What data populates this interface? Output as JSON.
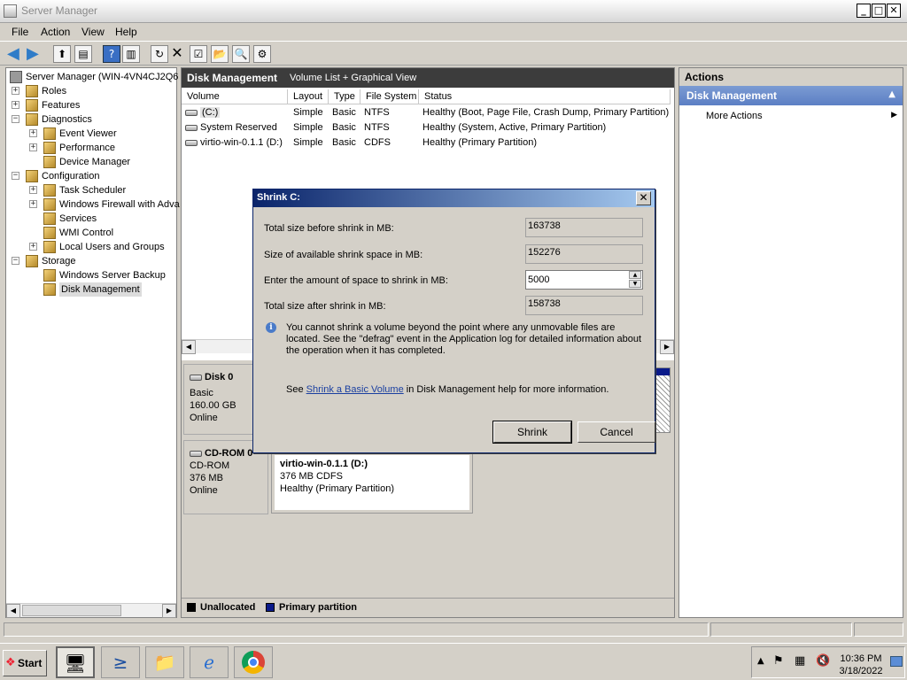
{
  "window": {
    "title": "Server Manager"
  },
  "menu": [
    "File",
    "Action",
    "View",
    "Help"
  ],
  "tree": {
    "root": "Server Manager (WIN-4VN4CJ2Q6",
    "items": [
      {
        "label": "Roles",
        "level": 1,
        "expander": "+"
      },
      {
        "label": "Features",
        "level": 1,
        "expander": "+"
      },
      {
        "label": "Diagnostics",
        "level": 1,
        "expander": "-"
      },
      {
        "label": "Event Viewer",
        "level": 2,
        "expander": "+"
      },
      {
        "label": "Performance",
        "level": 2,
        "expander": "+"
      },
      {
        "label": "Device Manager",
        "level": 2,
        "expander": ""
      },
      {
        "label": "Configuration",
        "level": 1,
        "expander": "-"
      },
      {
        "label": "Task Scheduler",
        "level": 2,
        "expander": "+"
      },
      {
        "label": "Windows Firewall with Adva",
        "level": 2,
        "expander": "+"
      },
      {
        "label": "Services",
        "level": 2,
        "expander": ""
      },
      {
        "label": "WMI Control",
        "level": 2,
        "expander": ""
      },
      {
        "label": "Local Users and Groups",
        "level": 2,
        "expander": "+"
      },
      {
        "label": "Storage",
        "level": 1,
        "expander": "-"
      },
      {
        "label": "Windows Server Backup",
        "level": 2,
        "expander": ""
      },
      {
        "label": "Disk Management",
        "level": 2,
        "expander": ""
      }
    ]
  },
  "center": {
    "title": "Disk Management",
    "view": "Volume List + Graphical View",
    "columns": [
      "Volume",
      "Layout",
      "Type",
      "File System",
      "Status"
    ],
    "rows": [
      {
        "volume": "(C:)",
        "layout": "Simple",
        "type": "Basic",
        "fs": "NTFS",
        "status": "Healthy (Boot, Page File, Crash Dump, Primary Partition)"
      },
      {
        "volume": "System Reserved",
        "layout": "Simple",
        "type": "Basic",
        "fs": "NTFS",
        "status": "Healthy (System, Active, Primary Partition)"
      },
      {
        "volume": "virtio-win-0.1.1 (D:)",
        "layout": "Simple",
        "type": "Basic",
        "fs": "CDFS",
        "status": "Healthy (Primary Partition)"
      }
    ],
    "disk0": {
      "name": "Disk 0",
      "type": "Basic",
      "size": "160.00 GB",
      "state": "Online"
    },
    "cdrom": {
      "name": "CD-ROM 0",
      "type": "CD-ROM",
      "size": "376 MB",
      "state": "Online",
      "vol_name": "virtio-win-0.1.1  (D:)",
      "vol_size": "376 MB CDFS",
      "vol_status": "Healthy (Primary Partition)"
    },
    "legend": {
      "unallocated": "Unallocated",
      "primary": "Primary partition"
    }
  },
  "actions": {
    "header": "Actions",
    "section": "Disk Management",
    "more": "More Actions"
  },
  "dialog": {
    "title": "Shrink C:",
    "total_before_label": "Total size before shrink in MB:",
    "total_before": "163738",
    "available_label": "Size of available shrink space in MB:",
    "available": "152276",
    "amount_label": "Enter the amount of space to shrink in MB:",
    "amount": "5000",
    "total_after_label": "Total size after shrink in MB:",
    "total_after": "158738",
    "note": "You cannot shrink a volume beyond the point where any unmovable files are located. See the \"defrag\" event in the Application log for detailed information about the operation when it has completed.",
    "see_prefix": "See ",
    "see_link": "Shrink a Basic Volume",
    "see_suffix": " in Disk Management help for more information.",
    "shrink": "Shrink",
    "cancel": "Cancel"
  },
  "taskbar": {
    "start": "Start",
    "time": "10:36 PM",
    "date": "3/18/2022"
  },
  "colors": {
    "accent": "#0a246a",
    "primary_partition": "#0a1a8a",
    "unallocated": "#000000"
  }
}
